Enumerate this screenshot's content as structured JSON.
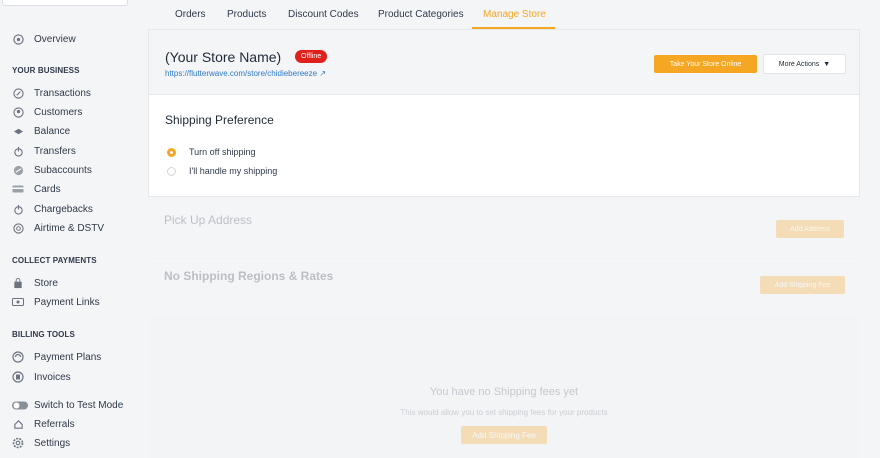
{
  "sidebar": {
    "overview": "Overview",
    "your_business_heading": "YOUR BUSINESS",
    "business_items": [
      "Transactions",
      "Customers",
      "Balance",
      "Transfers",
      "Subaccounts",
      "Cards",
      "Chargebacks",
      "Airtime & DSTV"
    ],
    "collect_payments_heading": "COLLECT PAYMENTS",
    "collect_items": [
      "Store",
      "Payment Links"
    ],
    "billing_tools_heading": "BILLING TOOLS",
    "billing_items": [
      "Payment Plans",
      "Invoices"
    ],
    "bottom_items": [
      "Switch to Test Mode",
      "Referrals",
      "Settings"
    ]
  },
  "tabs": [
    "Orders",
    "Products",
    "Discount Codes",
    "Product Categories",
    "Manage Store"
  ],
  "active_tab": "Manage Store",
  "store": {
    "name": "(Your Store Name)",
    "status_badge": "Offline",
    "url": "https://flutterwave.com/store/chidiebereeze",
    "take_online_label": "Take Your Store Online",
    "more_actions_label": "More Actions"
  },
  "shipping": {
    "title": "Shipping Preference",
    "options": [
      "Turn off shipping",
      "I'll handle my shipping"
    ],
    "selected": "Turn off shipping"
  },
  "pickup": {
    "title": "Pick Up Address",
    "add_label": "Add Address"
  },
  "regions": {
    "title": "No Shipping Regions & Rates",
    "add_label": "Add Shipping Fee"
  },
  "empty_state": {
    "title": "You have no Shipping fees yet",
    "subtitle": "This would allow you to set shipping fees for your products",
    "button_label": "Add Shipping Fee"
  },
  "colors": {
    "accent": "#f5a623",
    "offline": "#e0201b",
    "link": "#2f7ac7"
  }
}
